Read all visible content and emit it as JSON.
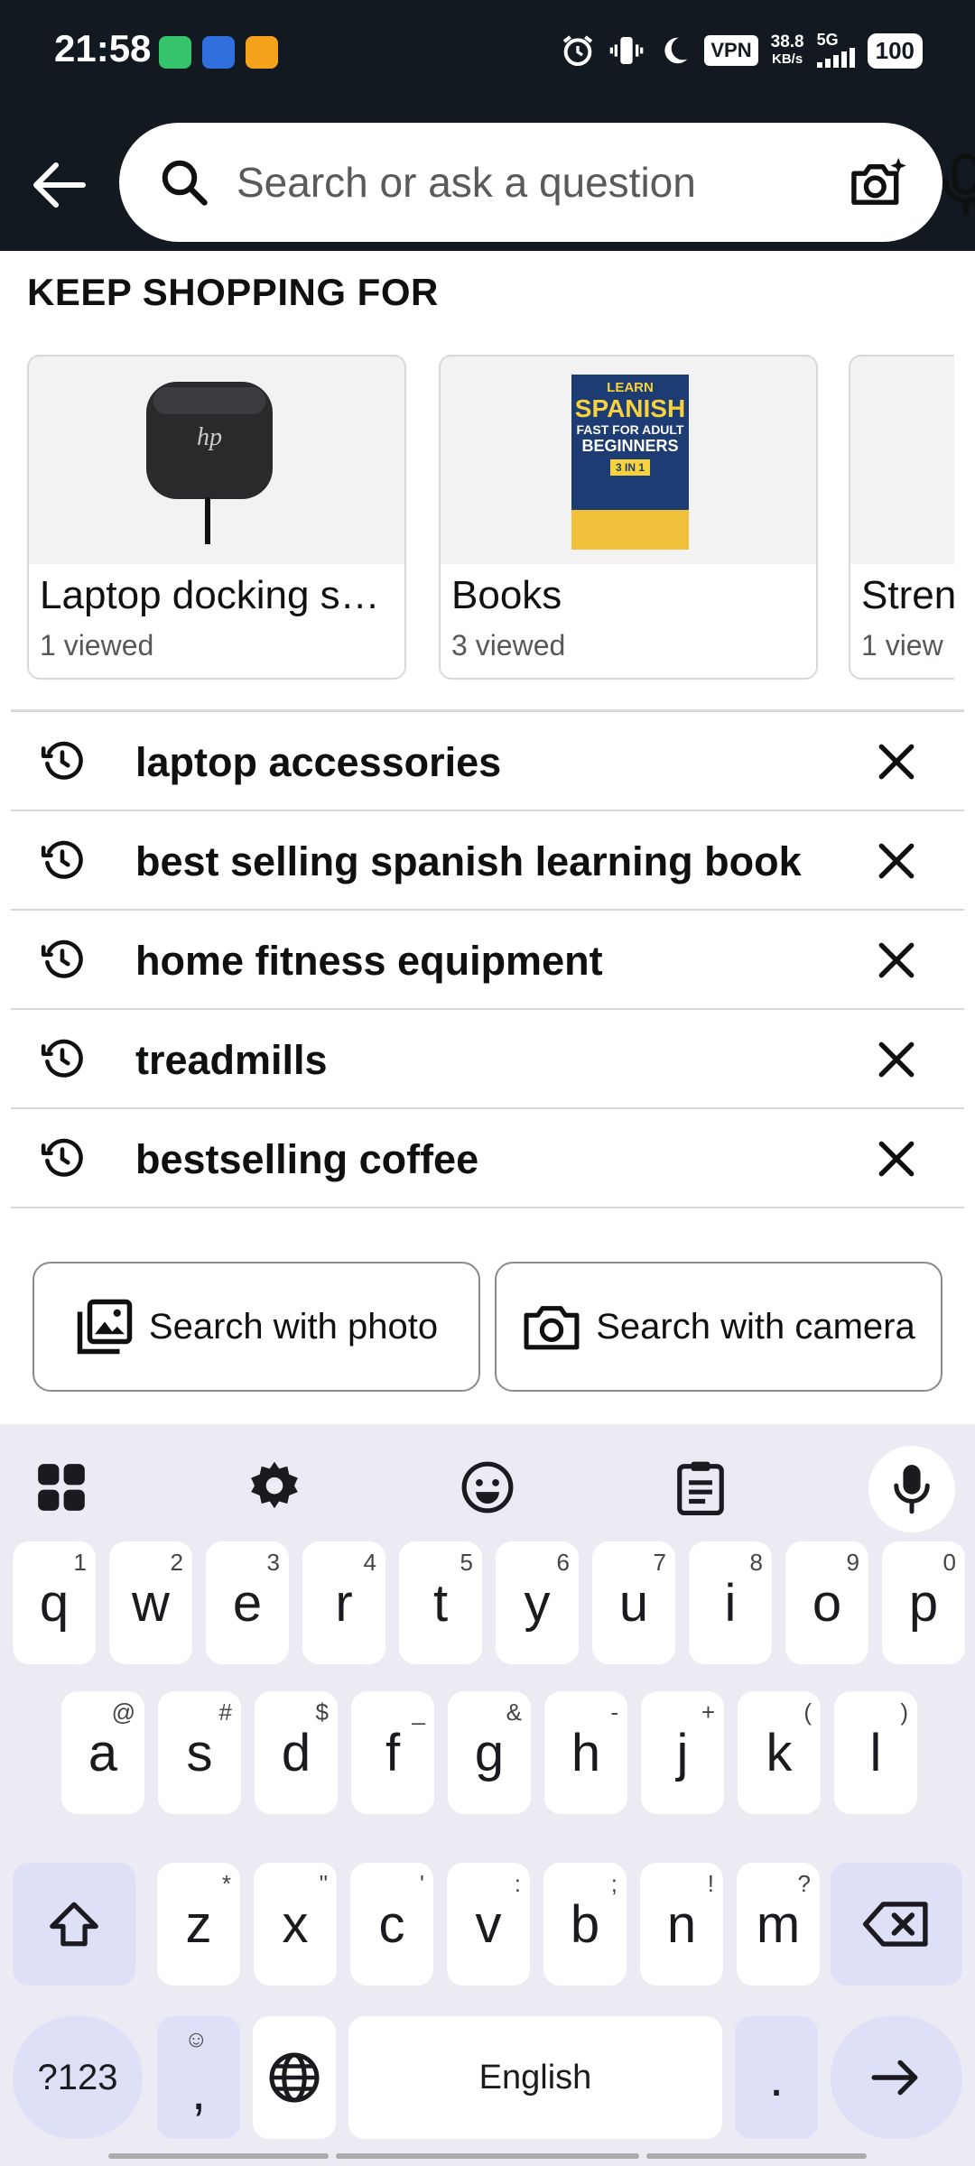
{
  "status_bar": {
    "time": "21:58",
    "vpn": "VPN",
    "speed_value": "38.8",
    "speed_unit": "KB/s",
    "network": "5G",
    "battery": "100"
  },
  "search": {
    "placeholder": "Search or ask a question"
  },
  "keep_shopping": {
    "title": "KEEP SHOPPING FOR",
    "cards": [
      {
        "name": "Laptop docking s…",
        "sub": "1 viewed"
      },
      {
        "name": "Books",
        "sub": "3 viewed"
      },
      {
        "name": "Stren",
        "sub": "1 view"
      }
    ],
    "book_cover": {
      "line1": "LEARN",
      "line2": "SPANISH",
      "line3": "FAST FOR ADULT",
      "line4": "BEGINNERS",
      "badge": "3 IN 1"
    }
  },
  "history": [
    "laptop accessories",
    "best selling spanish learning book",
    "home fitness equipment",
    "treadmills",
    "bestselling coffee"
  ],
  "search_with": {
    "photo": "Search with photo",
    "camera": "Search with camera"
  },
  "keyboard": {
    "row1": [
      {
        "k": "q",
        "h": "1"
      },
      {
        "k": "w",
        "h": "2"
      },
      {
        "k": "e",
        "h": "3"
      },
      {
        "k": "r",
        "h": "4"
      },
      {
        "k": "t",
        "h": "5"
      },
      {
        "k": "y",
        "h": "6"
      },
      {
        "k": "u",
        "h": "7"
      },
      {
        "k": "i",
        "h": "8"
      },
      {
        "k": "o",
        "h": "9"
      },
      {
        "k": "p",
        "h": "0"
      }
    ],
    "row2": [
      {
        "k": "a",
        "h": "@"
      },
      {
        "k": "s",
        "h": "#"
      },
      {
        "k": "d",
        "h": "$"
      },
      {
        "k": "f",
        "h": "_"
      },
      {
        "k": "g",
        "h": "&"
      },
      {
        "k": "h",
        "h": "-"
      },
      {
        "k": "j",
        "h": "+"
      },
      {
        "k": "k",
        "h": "("
      },
      {
        "k": "l",
        "h": ")"
      }
    ],
    "row3": [
      {
        "k": "z",
        "h": "*"
      },
      {
        "k": "x",
        "h": "\""
      },
      {
        "k": "c",
        "h": "'"
      },
      {
        "k": "v",
        "h": ":"
      },
      {
        "k": "b",
        "h": ";"
      },
      {
        "k": "n",
        "h": "!"
      },
      {
        "k": "m",
        "h": "?"
      }
    ],
    "symbols": "?123",
    "comma": ",",
    "space": "English",
    "period": "."
  }
}
